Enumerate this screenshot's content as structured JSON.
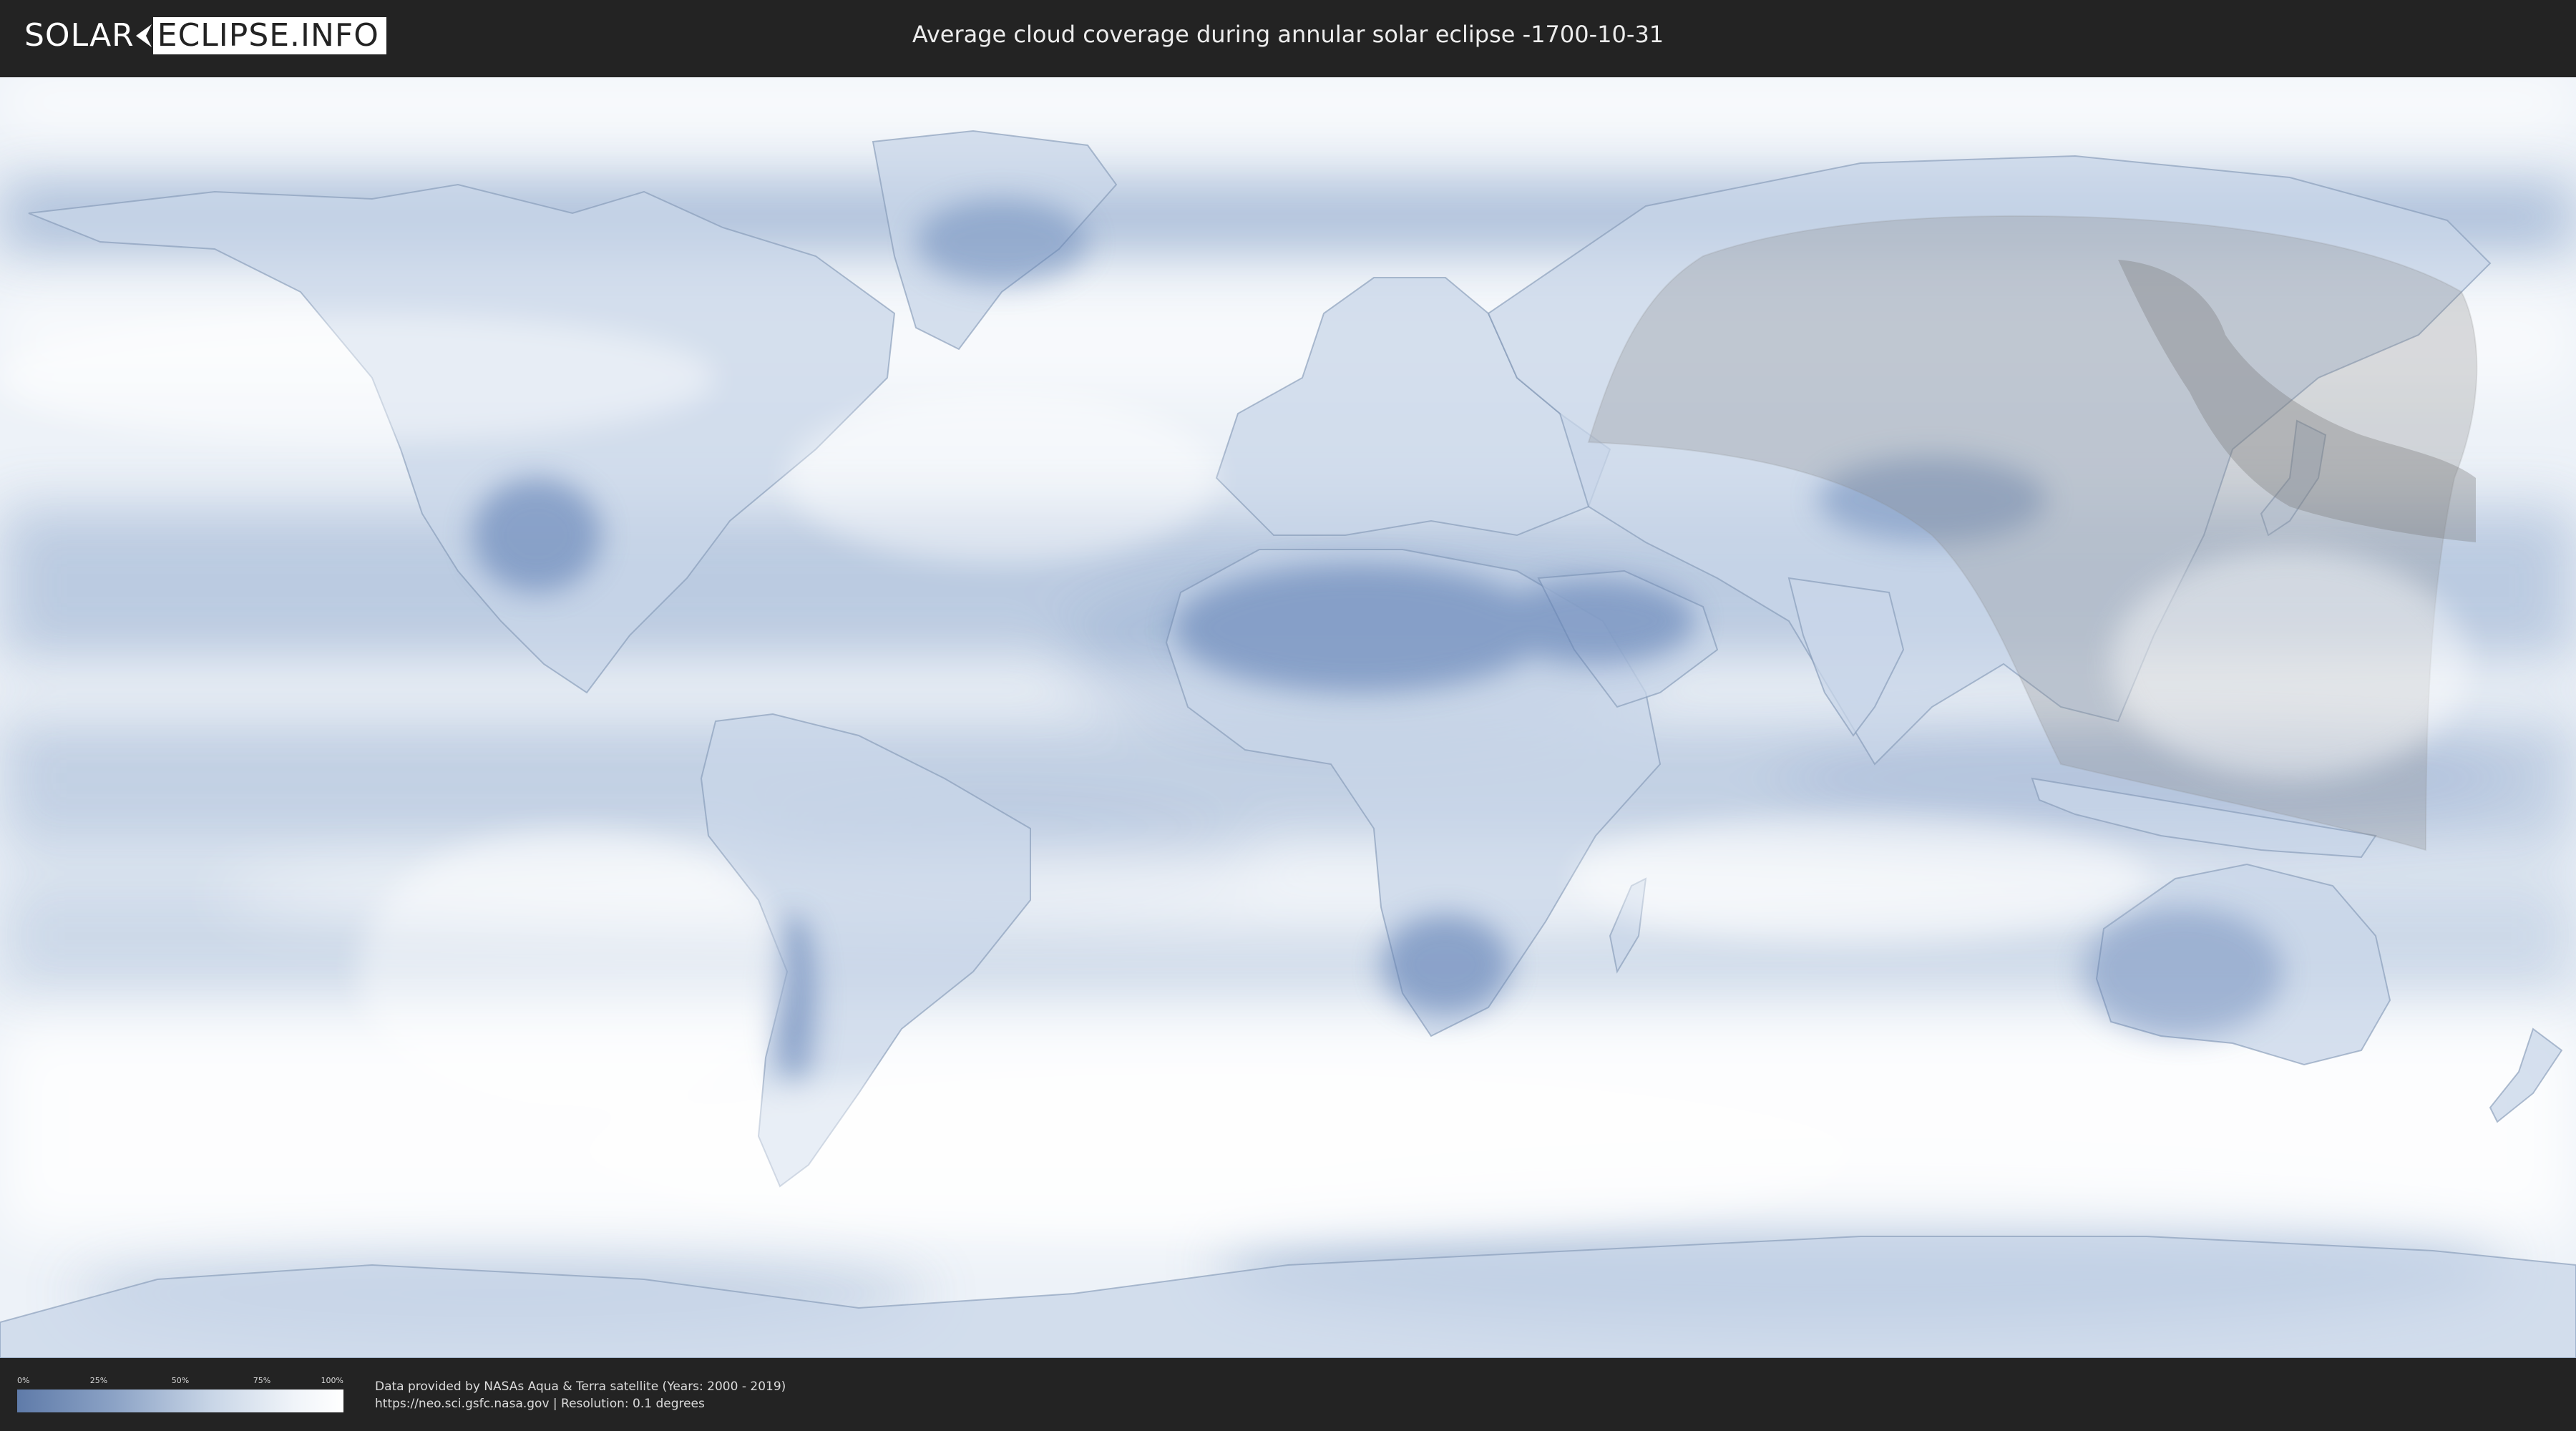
{
  "header": {
    "logo_left": "SOLAR",
    "logo_right": "ECLIPSE.INFO",
    "title": "Average cloud coverage during annular solar eclipse -1700-10-31"
  },
  "map": {
    "colors": {
      "ocean_clear": "#6f8fbf",
      "cloud": "#ffffff",
      "eclipse_shadow": "#8a8a8a"
    }
  },
  "legend": {
    "ticks": [
      "0%",
      "25%",
      "50%",
      "75%",
      "100%"
    ],
    "colors": {
      "low": "#5f7ba9",
      "high": "#ffffff"
    }
  },
  "footer": {
    "credit_line1": "Data provided by NASAs Aqua & Terra satellite (Years: 2000 - 2019)",
    "credit_line2": "https://neo.sci.gsfc.nasa.gov | Resolution: 0.1 degrees"
  }
}
